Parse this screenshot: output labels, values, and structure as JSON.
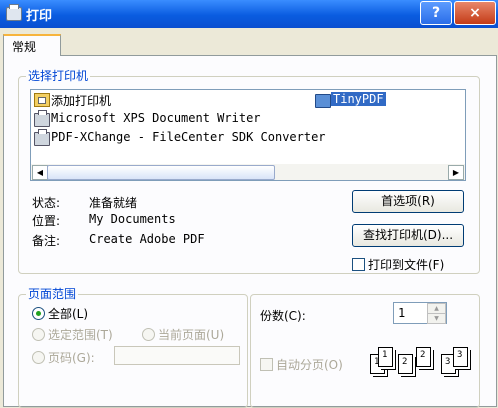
{
  "window": {
    "title": "打印",
    "help_label": "?",
    "close_label": "×"
  },
  "tabs": [
    {
      "label": "常规"
    }
  ],
  "select_printer": {
    "group_title": "选择打印机",
    "printers": [
      {
        "label": "添加打印机",
        "icon": "add-printer-icon"
      },
      {
        "label": "Microsoft XPS Document Writer",
        "icon": "printer-icon"
      },
      {
        "label": "PDF-XChange - FileCenter SDK Converter",
        "icon": "printer-icon"
      },
      {
        "label": "TinyPDF",
        "icon": "printer-icon",
        "selected": true
      }
    ],
    "status_label": "状态:",
    "status_value": "准备就绪",
    "location_label": "位置:",
    "location_value": "My Documents",
    "comment_label": "备注:",
    "comment_value": "Create Adobe PDF",
    "preferences_button": "首选项(R)",
    "find_printer_button": "查找打印机(D)...",
    "print_to_file_label": "打印到文件(F)"
  },
  "page_range": {
    "group_title": "页面范围",
    "all_label": "全部(L)",
    "selection_label": "选定范围(T)",
    "current_page_label": "当前页面(U)",
    "pages_label": "页码(G):",
    "pages_value": ""
  },
  "copies": {
    "label": "份数(C):",
    "value": "1",
    "collate_label": "自动分页(O)",
    "collate_pages": [
      "1",
      "1",
      "2",
      "2",
      "3",
      "3"
    ]
  }
}
